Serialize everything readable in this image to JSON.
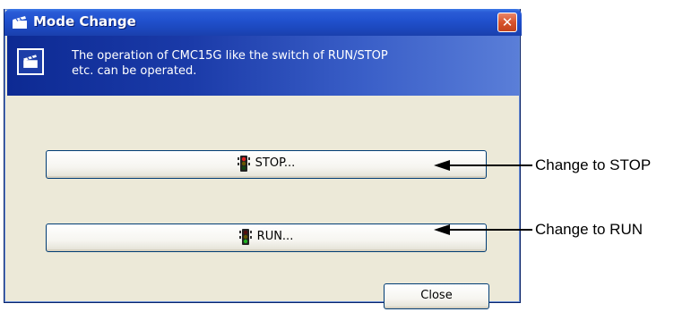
{
  "window": {
    "title": "Mode Change",
    "close_glyph": "✕",
    "title_icon": "clapperboard-icon"
  },
  "banner": {
    "icon": "clapperboard-icon",
    "text_line1": "The operation of CMC15G like the switch of RUN/STOP",
    "text_line2": "etc. can be operated."
  },
  "buttons": {
    "stop": {
      "label": "STOP...",
      "icon": "traffic-light-red-icon"
    },
    "run": {
      "label": "RUN...",
      "icon": "traffic-light-green-icon"
    },
    "close": {
      "label": "Close"
    }
  },
  "annotations": {
    "stop": "Change to STOP",
    "run": "Change to RUN"
  },
  "colors": {
    "titlebar": "#2152cf",
    "banner": "#1a3aa8",
    "window_bg": "#ece9d8",
    "close_button": "#d8532c",
    "stop_light": "#e02020",
    "run_light": "#20b020"
  }
}
